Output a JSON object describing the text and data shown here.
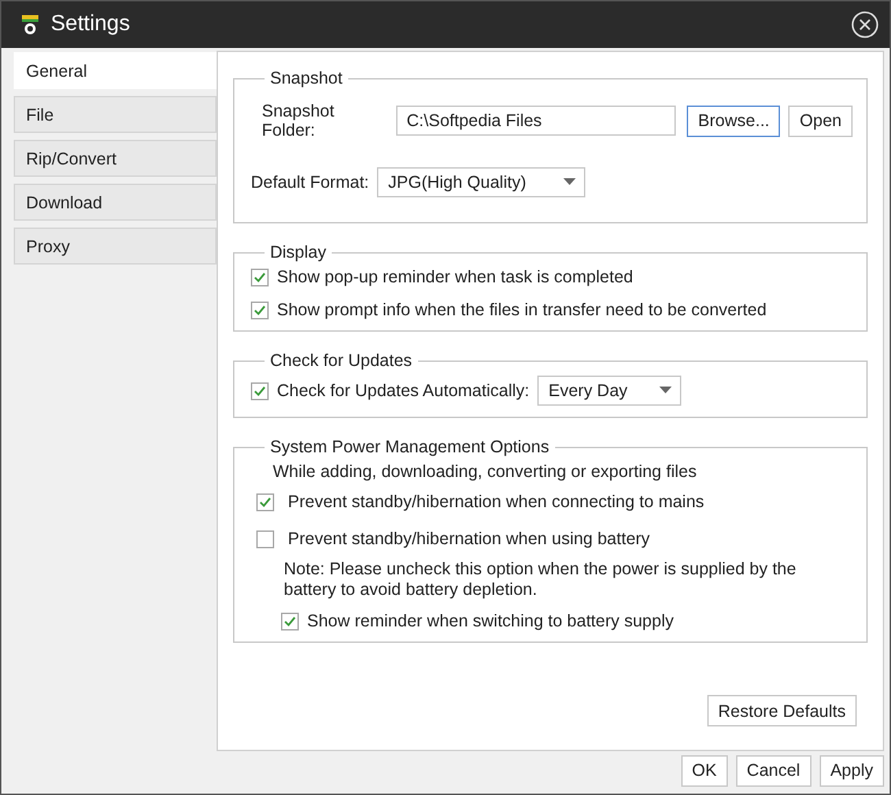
{
  "window": {
    "title": "Settings"
  },
  "tabs": [
    {
      "label": "General",
      "selected": true
    },
    {
      "label": "File",
      "selected": false
    },
    {
      "label": "Rip/Convert",
      "selected": false
    },
    {
      "label": "Download",
      "selected": false
    },
    {
      "label": "Proxy",
      "selected": false
    }
  ],
  "snapshot": {
    "title": "Snapshot",
    "folder_label": "Snapshot Folder:",
    "folder_value": "C:\\Softpedia Files",
    "buttons": [
      "Browse...",
      "Open"
    ],
    "format_label": "Default Format:",
    "format_value": "JPG(High Quality)"
  },
  "display": {
    "title": "Display",
    "options": [
      {
        "label": "Show pop-up reminder when task is completed",
        "checked": true
      },
      {
        "label": "Show prompt info when the files in transfer need to be converted",
        "checked": true
      }
    ]
  },
  "updates": {
    "title": "Check for Updates",
    "option": {
      "label": "Check for Updates Automatically:",
      "checked": true
    },
    "frequency": "Every Day"
  },
  "power": {
    "title": "System Power Management Options",
    "intro": "While adding, downloading, converting or exporting files",
    "options": [
      {
        "label": "Prevent standby/hibernation when connecting to mains",
        "checked": true
      },
      {
        "label": "Prevent standby/hibernation when using battery",
        "checked": false
      }
    ],
    "note": "Note: Please uncheck this option when the power is supplied by the battery to avoid battery depletion.",
    "reminder": {
      "label": "Show reminder when switching to battery supply",
      "checked": true
    }
  },
  "restore_button": "Restore Defaults",
  "buttons": [
    "OK",
    "Cancel",
    "Apply"
  ]
}
